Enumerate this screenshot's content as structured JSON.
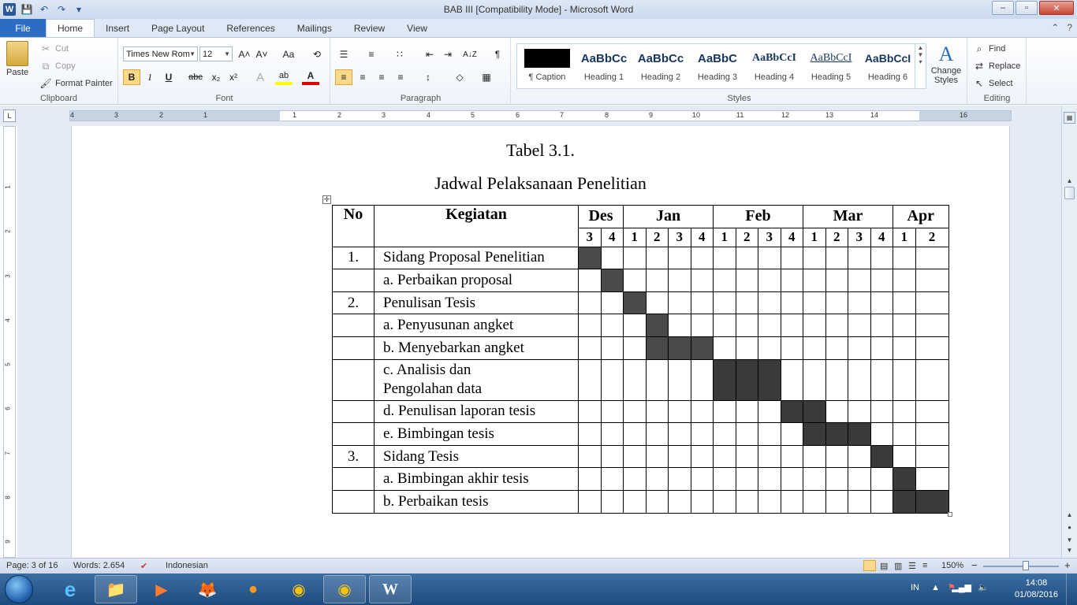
{
  "window": {
    "title": "BAB III [Compatibility Mode]  -  Microsoft Word",
    "app_logo": "W",
    "qat": [
      {
        "glyph": "💾"
      },
      {
        "glyph": "↶"
      },
      {
        "glyph": "↷"
      },
      {
        "glyph": "▾"
      }
    ],
    "buttons": {
      "minimize": "–",
      "maximize": "▫",
      "close": "✕"
    }
  },
  "tabs": [
    "File",
    "Home",
    "Insert",
    "Page Layout",
    "References",
    "Mailings",
    "Review",
    "View"
  ],
  "tabs_right": {
    "help": "?",
    "collapse": "⌃"
  },
  "ribbon": {
    "clipboard": {
      "label": "Clipboard",
      "paste": "Paste",
      "cut": "Cut",
      "copy": "Copy",
      "format_painter": "Format Painter"
    },
    "font": {
      "label": "Font",
      "font_name": "Times New Rom",
      "font_size": "12",
      "grow": "A˄",
      "shrink": "A˅",
      "change_case": "Aa",
      "clear": "⟲",
      "bold": "B",
      "italic": "I",
      "underline": "U",
      "strike": "abc",
      "subscript": "x₂",
      "superscript": "x²",
      "effects": "A",
      "highlight": "ab",
      "color": "A"
    },
    "paragraph": {
      "label": "Paragraph",
      "bullets": "☰",
      "numbering": "≡",
      "multilevel": "∷",
      "dec_indent": "⇤",
      "inc_indent": "⇥",
      "sort": "A↓Z",
      "pilcrow": "¶",
      "align_left": "≡",
      "center": "≡",
      "right": "≡",
      "justify": "≡",
      "spacing": "↕",
      "shading": "◇",
      "borders": "▦"
    },
    "styles": {
      "label": "Styles",
      "items": [
        {
          "preview": "",
          "name": "¶ Caption"
        },
        {
          "preview": "AaBbCc",
          "name": "Heading 1"
        },
        {
          "preview": "AaBbCc",
          "name": "Heading 2"
        },
        {
          "preview": "AaBbC",
          "name": "Heading 3"
        },
        {
          "preview": "AaBbCcI",
          "name": "Heading 4"
        },
        {
          "preview": "AaBbCcI",
          "name": "Heading 5"
        },
        {
          "preview": "AaBbCcI",
          "name": "Heading 6"
        }
      ],
      "change_styles": "Change Styles",
      "change_styles_icon": "A"
    },
    "editing": {
      "label": "Editing",
      "find": "Find",
      "replace": "Replace",
      "select": "Select"
    }
  },
  "ruler": {
    "h_numbers": [
      "4",
      "3",
      "2",
      "1",
      "1",
      "2",
      "3",
      "4",
      "5",
      "6",
      "7",
      "8",
      "9",
      "10",
      "11",
      "12",
      "13",
      "14",
      "16"
    ],
    "v_numbers": [
      "1",
      "2",
      "3",
      "4",
      "5",
      "6",
      "7",
      "8",
      "9"
    ],
    "corner": "L"
  },
  "document": {
    "caption": "Tabel 3.1.",
    "title": "Jadwal Pelaksanaan Penelitian",
    "table": {
      "handle_icon": "✛",
      "header": {
        "no": "No",
        "activity": "Kegiatan"
      },
      "months": [
        {
          "name": "Des",
          "weeks": [
            "3",
            "4"
          ]
        },
        {
          "name": "Jan",
          "weeks": [
            "1",
            "2",
            "3",
            "4"
          ]
        },
        {
          "name": "Feb",
          "weeks": [
            "1",
            "2",
            "3",
            "4"
          ]
        },
        {
          "name": "Mar",
          "weeks": [
            "1",
            "2",
            "3",
            "4"
          ]
        },
        {
          "name": "Apr",
          "weeks": [
            "1",
            "2"
          ]
        }
      ],
      "rows": [
        {
          "no": "1.",
          "activity": "Sidang Proposal Penelitian",
          "filled": [
            0
          ]
        },
        {
          "no": "",
          "activity": "a. Perbaikan proposal",
          "filled": [
            1
          ]
        },
        {
          "no": "2.",
          "activity": "Penulisan Tesis",
          "filled": [
            2
          ]
        },
        {
          "no": "",
          "activity": "a. Penyusunan angket",
          "filled": [
            3
          ]
        },
        {
          "no": "",
          "activity": "b. Menyebarkan angket",
          "filled": [
            3,
            4,
            5
          ]
        },
        {
          "no": "",
          "activity": "c. Analisis dan\nPengolahan data",
          "filled": [
            6,
            7,
            8
          ],
          "tall": true
        },
        {
          "no": "",
          "activity": "d. Penulisan laporan tesis",
          "filled": [
            9,
            10
          ]
        },
        {
          "no": "",
          "activity": "e. Bimbingan tesis",
          "filled": [
            10,
            11,
            12
          ]
        },
        {
          "no": "3.",
          "activity": "Sidang Tesis",
          "filled": [
            13
          ]
        },
        {
          "no": "",
          "activity": "a. Bimbingan akhir tesis",
          "filled": [
            14
          ]
        },
        {
          "no": "",
          "activity": "b. Perbaikan tesis",
          "filled": [
            14,
            15
          ]
        }
      ],
      "colors": {
        "filled_light": "#4a4a4a",
        "filled_dark": "#3a3a3a"
      }
    }
  },
  "statusbar": {
    "page": "Page: 3 of 16",
    "words": "Words: 2.654",
    "language": "Indonesian",
    "zoom": "150%",
    "zoom_out": "−",
    "zoom_in": "+"
  },
  "taskbar": {
    "apps": [
      {
        "name": "internet-explorer-icon",
        "glyph": "e",
        "open": false
      },
      {
        "name": "file-explorer-icon",
        "glyph": "📁",
        "open": true
      },
      {
        "name": "media-player-icon",
        "glyph": "▶",
        "open": false
      },
      {
        "name": "firefox-icon",
        "glyph": "🦊",
        "open": false
      },
      {
        "name": "app-orange-icon",
        "glyph": "●",
        "open": false
      },
      {
        "name": "chrome-icon",
        "glyph": "◉",
        "open": false
      },
      {
        "name": "chrome-icon-2",
        "glyph": "◉",
        "open": true
      },
      {
        "name": "word-icon",
        "glyph": "W",
        "open": true
      }
    ],
    "tray_lang": "IN",
    "time": "14:08",
    "date": "01/08/2016"
  }
}
